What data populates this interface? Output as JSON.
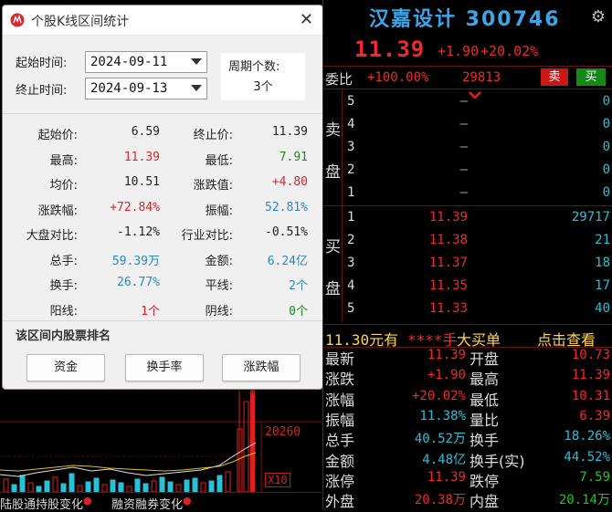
{
  "dialog": {
    "title": "个股K线区间统计",
    "start_label": "起始时间:",
    "start_value": "2024-09-11",
    "end_label": "终止时间:",
    "end_value": "2024-09-13",
    "period_label": "周期个数:",
    "period_value": "3个",
    "stats": [
      {
        "l1": "起始价:",
        "v1": "6.59",
        "c1": "dark",
        "l2": "终止价:",
        "v2": "11.39",
        "c2": "dark"
      },
      {
        "l1": "最高:",
        "v1": "11.39",
        "c1": "red",
        "l2": "最低:",
        "v2": "7.91",
        "c2": "green"
      },
      {
        "l1": "均价:",
        "v1": "10.51",
        "c1": "dark",
        "l2": "涨跌值:",
        "v2": "+4.80",
        "c2": "red"
      },
      {
        "l1": "涨跌幅:",
        "v1": "+72.84%",
        "c1": "red",
        "l2": "振幅:",
        "v2": "52.81%",
        "c2": "blue"
      },
      {
        "l1": "大盘对比:",
        "v1": "-1.12%",
        "c1": "dark",
        "l2": "行业对比:",
        "v2": "-0.51%",
        "c2": "dark"
      },
      {
        "l1": "总手:",
        "v1": "59.39万",
        "c1": "blue",
        "l2": "金额:",
        "v2": "6.24亿",
        "c2": "blue"
      },
      {
        "l1": "换手:",
        "v1": "26.77%",
        "c1": "blue",
        "l2": "平线:",
        "v2": "2个",
        "c2": "blue"
      },
      {
        "l1": "阳线:",
        "v1": "1个",
        "c1": "red",
        "l2": "阴线:",
        "v2": "0个",
        "c2": "green"
      }
    ],
    "rank_title": "该区间内股票排名",
    "rank_buttons": [
      "资金",
      "换手率",
      "涨跌幅"
    ]
  },
  "chart": {
    "vol_label": "20260",
    "x_label": "X10",
    "tabs": [
      "陆股通持股变化",
      "融资融券变化"
    ]
  },
  "panel": {
    "stock_name": "汉嘉设计 300746",
    "price": "11.39",
    "change": "+1.90",
    "change_pct": "+20.02%",
    "wb_label": "委比",
    "wb_pct": "+100.00%",
    "wb_num": "29813",
    "sell_btn": "卖",
    "buy_btn": "买",
    "sell_side_label": [
      "卖",
      "盘"
    ],
    "buy_side_label": [
      "买",
      "盘"
    ],
    "asks": [
      {
        "level": "5",
        "price": "–",
        "vol": "0"
      },
      {
        "level": "4",
        "price": "–",
        "vol": "0"
      },
      {
        "level": "3",
        "price": "–",
        "vol": "0"
      },
      {
        "level": "2",
        "price": "–",
        "vol": "0"
      },
      {
        "level": "1",
        "price": "–",
        "vol": "0"
      }
    ],
    "bids": [
      {
        "level": "1",
        "price": "11.39",
        "vol": "29717"
      },
      {
        "level": "2",
        "price": "11.38",
        "vol": "21"
      },
      {
        "level": "3",
        "price": "11.37",
        "vol": "18"
      },
      {
        "level": "4",
        "price": "11.35",
        "vol": "17"
      },
      {
        "level": "5",
        "price": "11.33",
        "vol": "40"
      }
    ],
    "bigbuy": {
      "a": "11.30元有",
      "b": "****手",
      "c": "大买单",
      "d": "点击查看"
    },
    "quotes": [
      {
        "l1": "最新",
        "v1": "11.39",
        "c1": "#f02a2a",
        "l2": "开盘",
        "v2": "10.73",
        "c2": "#f02a2a"
      },
      {
        "l1": "涨跌",
        "v1": "+1.90",
        "c1": "#f02a2a",
        "l2": "最高",
        "v2": "11.39",
        "c2": "#f02a2a"
      },
      {
        "l1": "涨幅",
        "v1": "+20.02%",
        "c1": "#f02a2a",
        "l2": "最低",
        "v2": "10.31",
        "c2": "#f02a2a"
      },
      {
        "l1": "振幅",
        "v1": "11.38%",
        "c1": "#2bc0d8",
        "l2": "量比",
        "v2": "6.39",
        "c2": "#f02a2a"
      },
      {
        "l1": "总手",
        "v1": "40.52万",
        "c1": "#2bc0d8",
        "l2": "换手",
        "v2": "18.26%",
        "c2": "#2bc0d8"
      },
      {
        "l1": "金额",
        "v1": "4.48亿",
        "c1": "#2bc0d8",
        "l2": "换手(实)",
        "v2": "44.52%",
        "c2": "#2bc0d8"
      },
      {
        "l1": "涨停",
        "v1": "11.39",
        "c1": "#f02a2a",
        "l2": "跌停",
        "v2": "7.59",
        "c2": "#1ec81e"
      },
      {
        "l1": "外盘",
        "v1": "20.38万",
        "c1": "#f02a2a",
        "l2": "内盘",
        "v2": "20.14万",
        "c2": "#1ec81e"
      }
    ]
  }
}
